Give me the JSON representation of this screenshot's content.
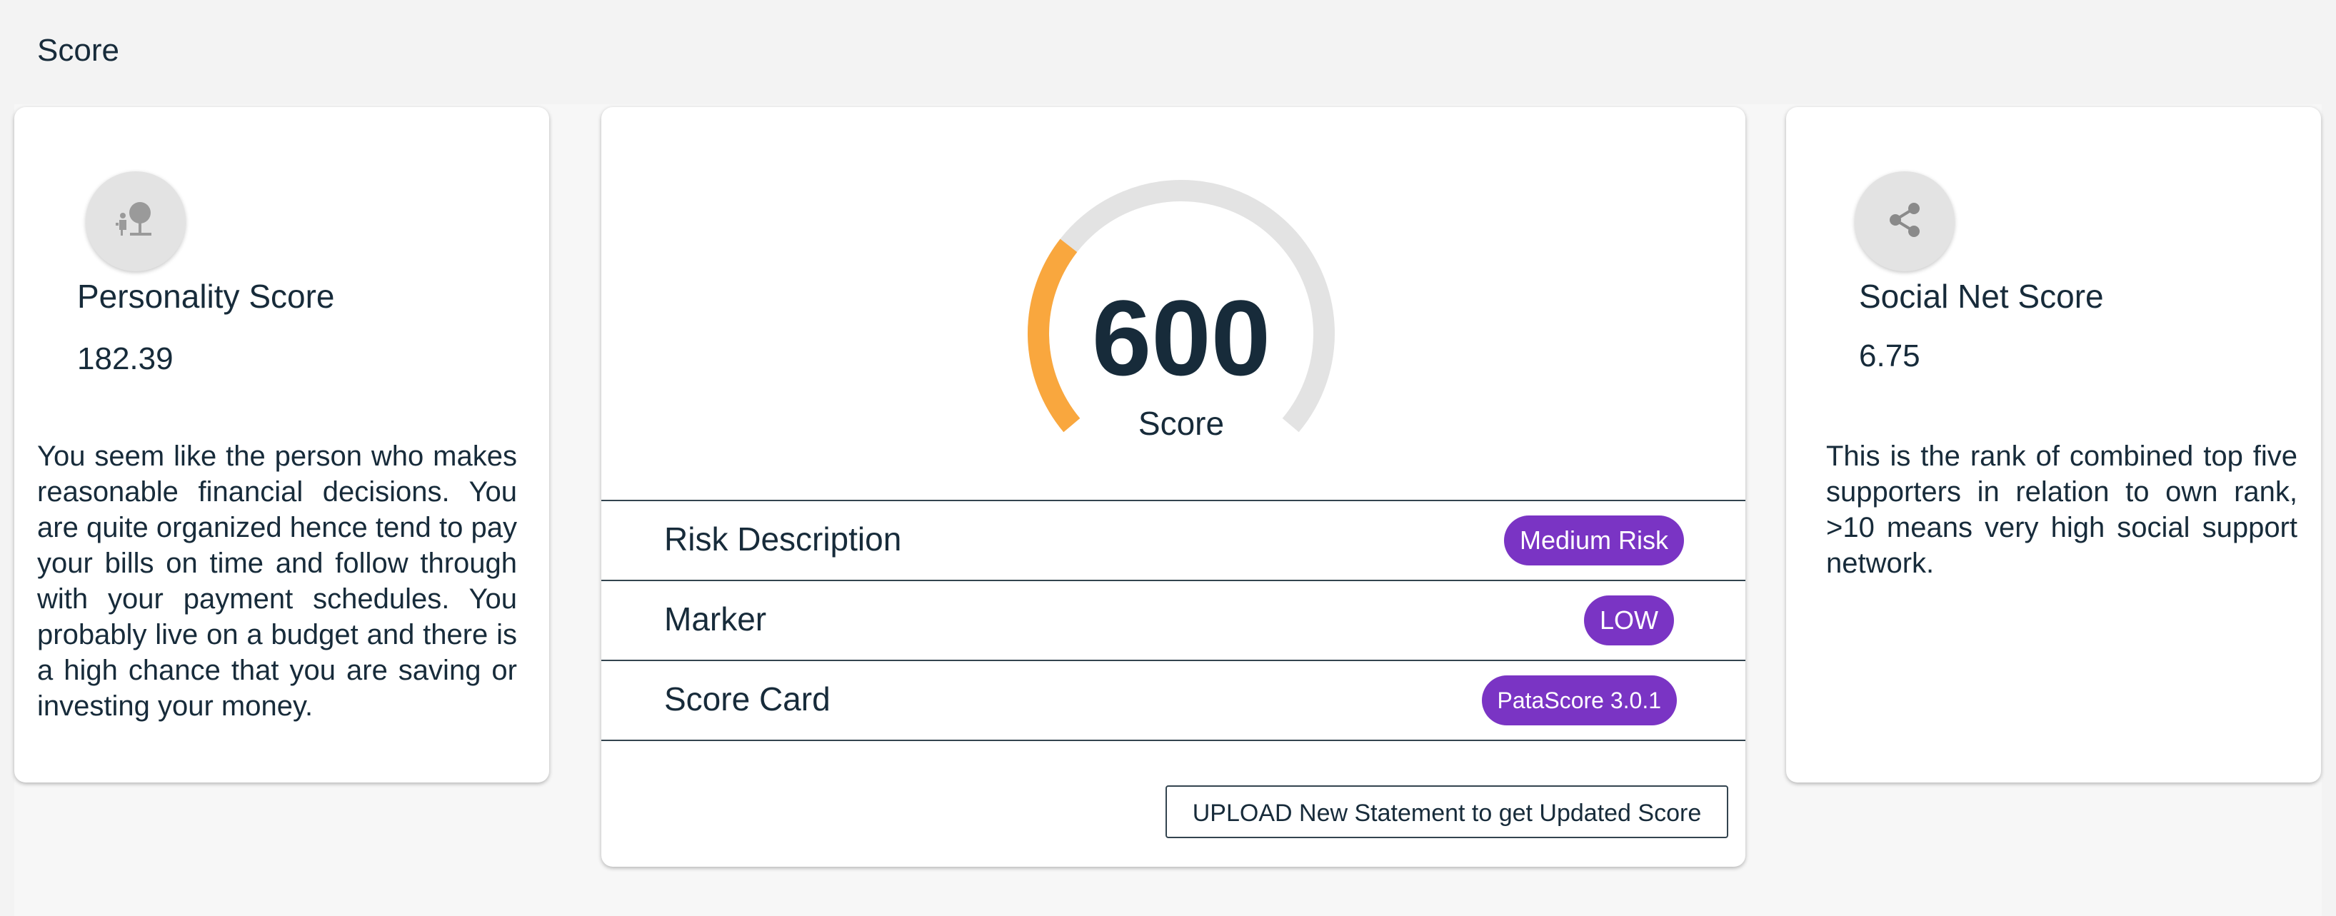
{
  "page": {
    "title": "Score"
  },
  "personality": {
    "icon": "person-at-tree-icon",
    "title": "Personality Score",
    "value": "182.39",
    "description": "You seem like the person who makes reasonable financial decisions. You are quite organized hence tend to pay your bills on time and follow through with your payment schedules. You probably live on a budget and there is a high chance that you are saving or investing your money."
  },
  "score": {
    "value": "600",
    "label": "Score",
    "gauge_fraction": 0.3,
    "gauge_color": "#f9a73e",
    "track_color": "#e3e3e3",
    "rows": [
      {
        "label": "Risk Description",
        "badge": "Medium Risk"
      },
      {
        "label": "Marker",
        "badge": "LOW"
      },
      {
        "label": "Score Card",
        "badge": "PataScore 3.0.1"
      }
    ],
    "badge_color": "#7a34c4",
    "upload_label": "UPLOAD New Statement to get Updated Score"
  },
  "social": {
    "icon": "share-icon",
    "title": "Social Net Score",
    "value": "6.75",
    "description": "This is the rank of combined top five supporters in relation to own rank, >10 means very high social support network."
  }
}
